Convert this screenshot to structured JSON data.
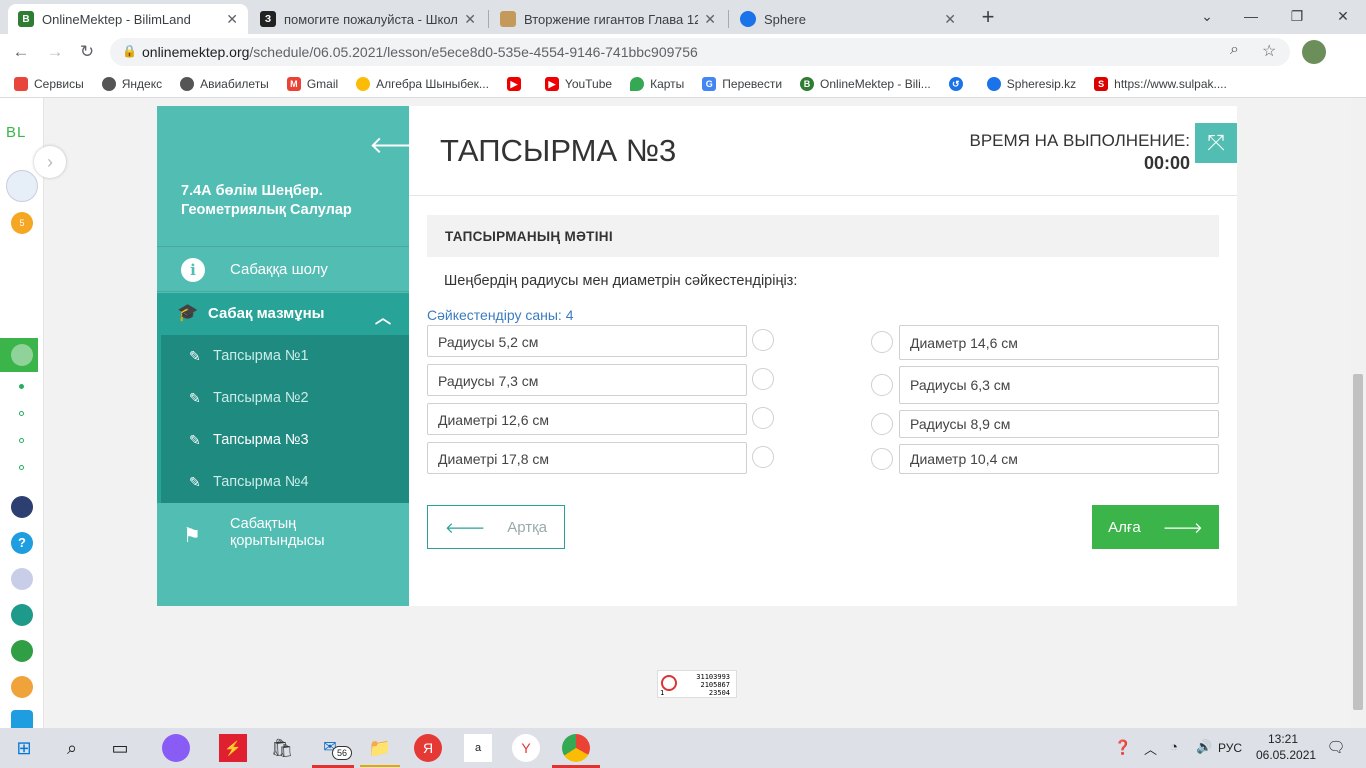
{
  "browser": {
    "tabs": [
      {
        "title": "OnlineMektep - BilimLand",
        "icon": "bilimland-icon",
        "color": "#2e7d32"
      },
      {
        "title": "помогите пожалуйста - Школь",
        "icon": "znanija-icon",
        "color": "#222222"
      },
      {
        "title": "Вторжение гигантов Глава 125",
        "icon": "manga-icon",
        "color": "#c49a5c"
      },
      {
        "title": "Sphere",
        "icon": "sphere-icon",
        "color": "#1a73e8"
      }
    ],
    "url": {
      "host": "onlinemektep.org",
      "path": "/schedule/06.05.2021/lesson/e5ece8d0-535e-4554-9146-741bbc909756"
    },
    "bookmarks": [
      "Сервисы",
      "Яндекс",
      "Авиабилеты",
      "Gmail",
      "Алгебра Шыныбек...",
      "",
      "YouTube",
      "Карты",
      "Перевести",
      "OnlineMektep - Bili...",
      "",
      "Spheresip.kz",
      "https://www.sulpak...."
    ]
  },
  "sidebar_badge": "5",
  "course_nav": {
    "lesson_title": "7.4А бөлім Шеңбер. Геометриялық Салулар",
    "overview": "Сабаққа шолу",
    "content": "Сабақ мазмұны",
    "tasks": [
      "Тапсырма №1",
      "Тапсырма №2",
      "Тапсырма №3",
      "Тапсырма №4"
    ],
    "current_task_index": 2,
    "summary": "Сабақтың қорытындысы"
  },
  "task": {
    "title": "ТАПСЫРМА №3",
    "timer_label": "ВРЕМЯ НА ВЫПОЛНЕНИЕ:",
    "timer_value": "00:00",
    "section_label": "ТАПСЫРМАНЫҢ МӘТІНІ",
    "prompt": "Шеңбердің радиусы мен диаметрін сәйкестендіріңіз:",
    "match_count": "Сәйкестендіру саны: 4",
    "left_items": [
      "Радиусы 5,2 см",
      "Радиусы 7,3 см",
      "Диаметрі 12,6 см",
      "Диаметрі 17,8 см"
    ],
    "right_items": [
      "Диаметр 14,6 см",
      "Радиусы 6,3 см",
      "Радиусы 8,9 см",
      "Диаметр 10,4 см"
    ],
    "back_label": "Артқа",
    "next_label": "Алға"
  },
  "badge_counts": [
    "31103993",
    "2105867",
    "23504"
  ],
  "badge_left": "1",
  "taskbar": {
    "mail_count": "56",
    "language": "РУС",
    "time": "13:21",
    "date": "06.05.2021"
  },
  "colors": {
    "teal": "#52bdb3",
    "teal_dark": "#27a398",
    "teal_darker": "#1f8a80",
    "green": "#3bb54a",
    "link_blue": "#3b7bbf"
  }
}
